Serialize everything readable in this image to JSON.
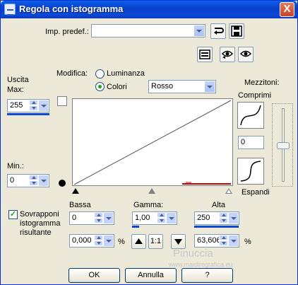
{
  "window": {
    "title": "Regola con istogramma",
    "close_label": "X"
  },
  "preset": {
    "label": "Imp. predef.:",
    "value": ""
  },
  "output": {
    "label_line1": "Uscita",
    "label_line2": "Max:",
    "max_value": "255",
    "min_label": "Min.:",
    "min_value": "0"
  },
  "modify": {
    "label": "Modifica:",
    "luminance_label": "Luminanza",
    "colors_label": "Colori",
    "selected": "colors",
    "channel_value": "Rosso"
  },
  "midtones": {
    "label": "Mezzitoni:",
    "compress_label": "Comprimi",
    "value": "0",
    "expand_label": "Espandi"
  },
  "overlay": {
    "checked": true,
    "label_line1": "Sovrapponi",
    "label_line2": "istogramma",
    "label_line3": "risultante"
  },
  "low": {
    "label": "Bassa",
    "value": "0",
    "percent_value": "0,000"
  },
  "gamma": {
    "label": "Gamma:",
    "value": "1,00",
    "ratio_label": "1:1"
  },
  "high": {
    "label": "Alta",
    "value": "250",
    "percent_value": "63,606"
  },
  "percent_sign": "%",
  "buttons": {
    "ok": "OK",
    "cancel": "Annulla",
    "help": "?"
  },
  "watermark": {
    "line1": "Pinuccia",
    "line2": "www.maidiregrafica.eu"
  },
  "colors": {
    "titlebar": "#0a48d8",
    "dialog_bg": "#ece9d8",
    "accent": "#0a48d8",
    "histogram_red": "#c00000"
  },
  "icons": [
    "dialog-icon",
    "close-icon",
    "reset-icon",
    "save-icon",
    "preview-icon",
    "eye-icon",
    "eye-toggle-icon"
  ]
}
